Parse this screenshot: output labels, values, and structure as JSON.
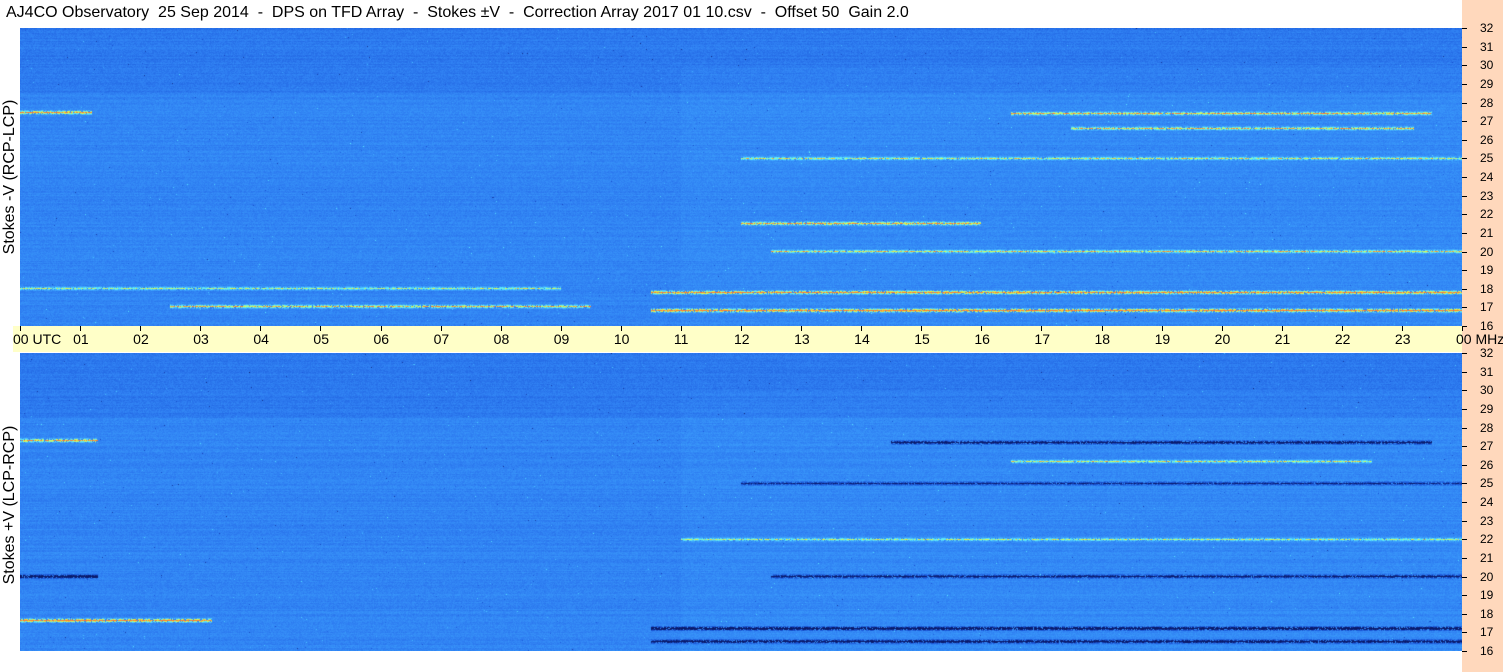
{
  "title": "AJ4CO Observatory  25 Sep 2014  -  DPS on TFD Array  -  Stokes ±V  -  Correction Array 2017 01 10.csv  -  Offset 50  Gain 2.0",
  "chart_data": [
    {
      "type": "heatmap",
      "panel": "top",
      "ylabel": "Stokes -V (RCP-LCP)",
      "yunit": "MHz",
      "ylim": [
        16,
        32
      ],
      "y_ticks": [
        "32",
        "31",
        "30",
        "29",
        "28",
        "27",
        "26",
        "25",
        "24",
        "23",
        "22",
        "21",
        "20",
        "19",
        "18",
        "17",
        "16"
      ],
      "xlim": [
        "00",
        "00"
      ],
      "colormap": [
        "#0a1a6a",
        "#1a56d8",
        "#2f7ff2",
        "#3fa6ff",
        "#5cf0ff",
        "#e8ff40",
        "#ff7a30"
      ],
      "features": [
        {
          "freq": 27.5,
          "start": 0.0,
          "end": 1.2,
          "intensity": 0.75
        },
        {
          "freq": 27.4,
          "start": 16.5,
          "end": 23.5,
          "intensity": 0.65
        },
        {
          "freq": 26.6,
          "start": 17.5,
          "end": 23.2,
          "intensity": 0.6
        },
        {
          "freq": 25.0,
          "start": 12.0,
          "end": 24.0,
          "intensity": 0.5
        },
        {
          "freq": 21.5,
          "start": 12.0,
          "end": 16.0,
          "intensity": 0.7
        },
        {
          "freq": 20.0,
          "start": 12.5,
          "end": 24.0,
          "intensity": 0.55
        },
        {
          "freq": 18.0,
          "start": 0.0,
          "end": 9.0,
          "intensity": 0.45
        },
        {
          "freq": 17.8,
          "start": 10.5,
          "end": 24.0,
          "intensity": 0.8
        },
        {
          "freq": 17.0,
          "start": 2.5,
          "end": 9.5,
          "intensity": 0.6
        },
        {
          "freq": 16.8,
          "start": 10.5,
          "end": 24.0,
          "intensity": 0.85
        }
      ]
    },
    {
      "type": "heatmap",
      "panel": "bottom",
      "ylabel": "Stokes +V (LCP-RCP)",
      "yunit": "MHz",
      "ylim": [
        16,
        32
      ],
      "y_ticks": [
        "32",
        "31",
        "30",
        "29",
        "28",
        "27",
        "26",
        "25",
        "24",
        "23",
        "22",
        "21",
        "20",
        "19",
        "18",
        "17",
        "16"
      ],
      "xlim": [
        "00",
        "00"
      ],
      "colormap": [
        "#0a1a6a",
        "#1a56d8",
        "#2f7ff2",
        "#3fa6ff",
        "#5cf0ff",
        "#e8ff40",
        "#ff7a30"
      ],
      "features": [
        {
          "freq": 27.3,
          "start": 0.0,
          "end": 1.3,
          "intensity": 0.7
        },
        {
          "freq": 27.2,
          "start": 14.5,
          "end": 23.5,
          "intensity": -0.55
        },
        {
          "freq": 26.2,
          "start": 16.5,
          "end": 22.5,
          "intensity": 0.5
        },
        {
          "freq": 25.0,
          "start": 12.0,
          "end": 24.0,
          "intensity": -0.4
        },
        {
          "freq": 22.0,
          "start": 11.0,
          "end": 24.0,
          "intensity": 0.45
        },
        {
          "freq": 20.0,
          "start": 0.0,
          "end": 1.3,
          "intensity": -0.7
        },
        {
          "freq": 20.0,
          "start": 12.5,
          "end": 24.0,
          "intensity": -0.5
        },
        {
          "freq": 17.6,
          "start": 0.0,
          "end": 3.2,
          "intensity": 0.85
        },
        {
          "freq": 17.2,
          "start": 10.5,
          "end": 24.0,
          "intensity": -0.7
        },
        {
          "freq": 16.5,
          "start": 10.5,
          "end": 24.0,
          "intensity": -0.6
        }
      ]
    }
  ],
  "time_axis": {
    "labels": [
      "00 UTC",
      "01",
      "02",
      "03",
      "04",
      "05",
      "06",
      "07",
      "08",
      "09",
      "10",
      "11",
      "12",
      "13",
      "14",
      "15",
      "16",
      "17",
      "18",
      "19",
      "20",
      "21",
      "22",
      "23",
      "00 MHz"
    ]
  }
}
